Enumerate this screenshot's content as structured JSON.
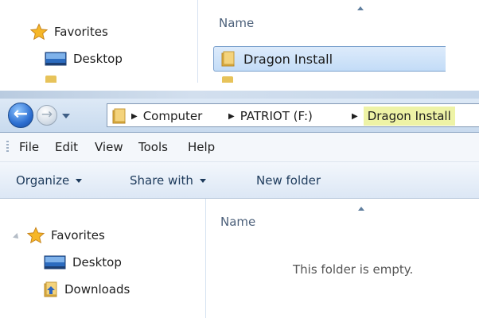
{
  "top_crop": {
    "favorites_label": "Favorites",
    "desktop_label": "Desktop",
    "column_name": "Name",
    "selected_item": "Dragon Install"
  },
  "navigation": {
    "breadcrumbs": [
      "Computer",
      "PATRIOT (F:)",
      "Dragon Install"
    ],
    "highlight_color": "#eef3a6"
  },
  "menu": [
    "File",
    "Edit",
    "View",
    "Tools",
    "Help"
  ],
  "toolbar": {
    "organize": "Organize",
    "share_with": "Share with",
    "new_folder": "New folder"
  },
  "nav_pane": {
    "favorites": "Favorites",
    "desktop": "Desktop",
    "downloads": "Downloads"
  },
  "file_list": {
    "column_name": "Name",
    "empty_message": "This folder is empty."
  },
  "icons": {
    "favorites": "star-icon",
    "desktop": "desktop-icon",
    "downloads": "downloads-folder-icon",
    "folder": "folder-icon",
    "back": "back-arrow-icon",
    "forward": "forward-arrow-icon"
  }
}
